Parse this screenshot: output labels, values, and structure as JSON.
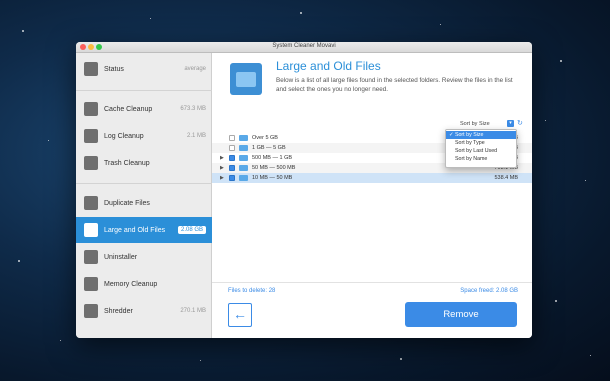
{
  "window": {
    "title": "System Cleaner Movavi"
  },
  "sidebar": {
    "items": [
      {
        "label": "Status",
        "value": "average",
        "icon": "monitor-icon"
      },
      {
        "label": "Cache Cleanup",
        "value": "673.3 MB",
        "icon": "magnifier-icon"
      },
      {
        "label": "Log Cleanup",
        "value": "2.1 MB",
        "icon": "magnifier-document-icon"
      },
      {
        "label": "Trash Cleanup",
        "value": "",
        "icon": "trash-icon"
      },
      {
        "label": "Duplicate Files",
        "value": "",
        "icon": "duplicate-files-icon"
      },
      {
        "label": "Large and Old Files",
        "value": "2.08 GB",
        "icon": "large-files-icon"
      },
      {
        "label": "Uninstaller",
        "value": "",
        "icon": "uninstaller-icon"
      },
      {
        "label": "Memory Cleanup",
        "value": "",
        "icon": "memory-chip-icon"
      },
      {
        "label": "Shredder",
        "value": "270.1 MB",
        "icon": "shredder-icon"
      }
    ]
  },
  "header": {
    "title": "Large and Old Files",
    "description": "Below is a list of all large files found in the selected folders. Review the files in the list and select the ones you no longer need."
  },
  "sort": {
    "label": "Sort by Size",
    "options": [
      "Sort by Size",
      "Sort by Type",
      "Sort by Last Used",
      "Sort by Name"
    ],
    "selected": "Sort by Size",
    "check_mark": "✓"
  },
  "files": [
    {
      "name": "Over 5 GB",
      "size": "MB",
      "checked": false,
      "expandable": false
    },
    {
      "name": "1 GB — 5 GB",
      "size": "MB",
      "checked": false,
      "expandable": false
    },
    {
      "name": "500 MB — 1 GB",
      "size": "MB",
      "checked": true,
      "expandable": true
    },
    {
      "name": "50 MB — 500 MB",
      "size": "703.1 MB",
      "checked": true,
      "expandable": true
    },
    {
      "name": "10 MB — 50 MB",
      "size": "538.4 MB",
      "checked": true,
      "expandable": true
    }
  ],
  "footer": {
    "files_to_delete": "Files to delete: 28",
    "space_freed": "Space freed: 2.08 GB",
    "back_glyph": "←",
    "remove_label": "Remove"
  },
  "colors": {
    "accent": "#3b8be6",
    "sidebar_active": "#2b8fd8",
    "sidebar_bg": "#ececec"
  }
}
